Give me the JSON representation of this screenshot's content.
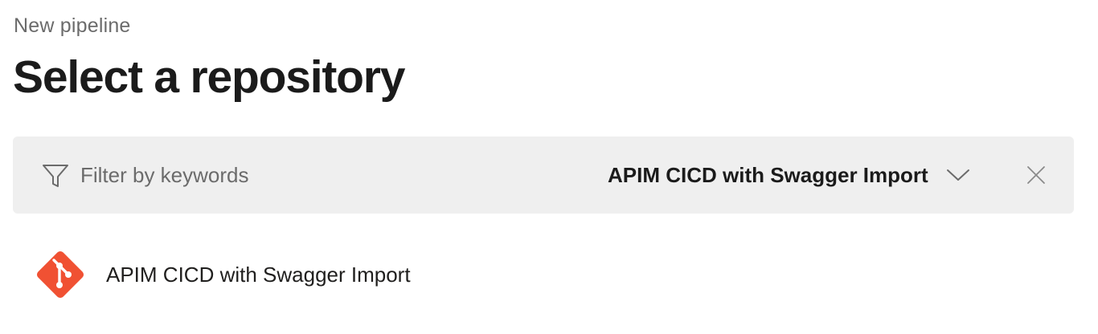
{
  "header": {
    "breadcrumb": "New pipeline",
    "title": "Select a repository"
  },
  "filter": {
    "icon": "filter-icon",
    "placeholder": "Filter by keywords",
    "value": "",
    "selected_repository": "APIM CICD with Swagger Import",
    "dropdown_icon": "chevron-down-icon",
    "clear_icon": "close-icon"
  },
  "repositories": [
    {
      "name": "APIM CICD with Swagger Import",
      "icon": "git-icon",
      "icon_color": "#f05133"
    }
  ],
  "colors": {
    "filter_bar_bg": "#efefef",
    "git_brand": "#f05133",
    "muted_text": "#6b6b6b"
  }
}
